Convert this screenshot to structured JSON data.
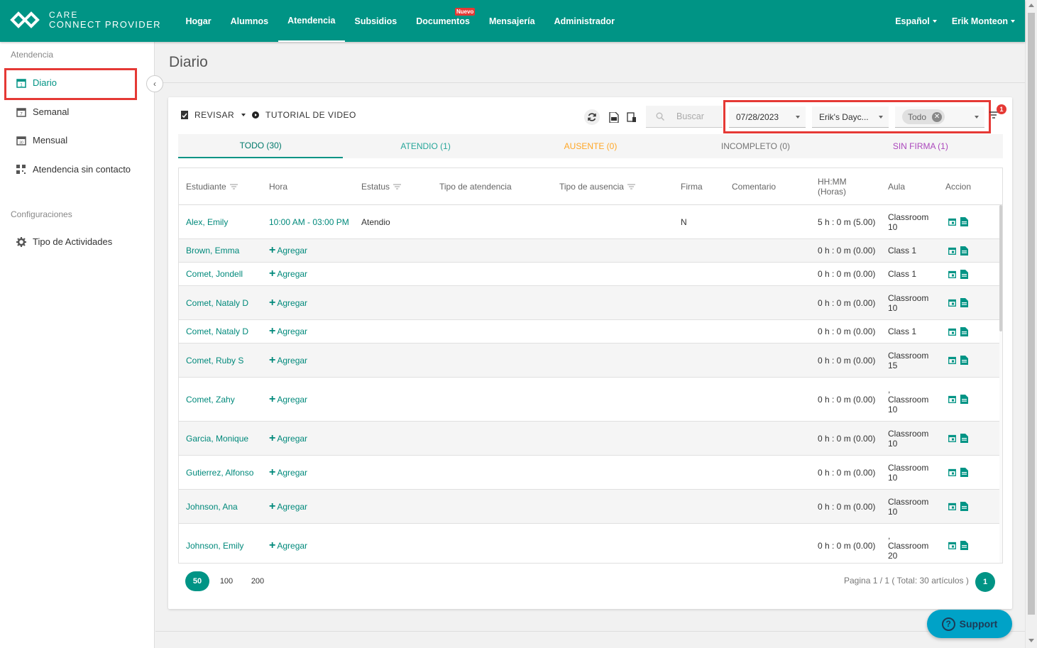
{
  "app": {
    "logo_line1": "CARE",
    "logo_line2": "CONNECT PROVIDER"
  },
  "nav": {
    "items": [
      "Hogar",
      "Alumnos",
      "Atendencia",
      "Subsidios",
      "Documentos",
      "Mensajería",
      "Administrador"
    ],
    "active": "Atendencia",
    "new_badge": "Nuevo"
  },
  "top_right": {
    "language": "Español",
    "user": "Erik Monteon"
  },
  "sidebar": {
    "section1": "Atendencia",
    "items": [
      {
        "label": "Diario",
        "icon": "calendar-day-icon",
        "active": true
      },
      {
        "label": "Semanal",
        "icon": "calendar-week-icon"
      },
      {
        "label": "Mensual",
        "icon": "calendar-month-icon"
      },
      {
        "label": "Atendencia sin contacto",
        "icon": "qr-code-icon"
      }
    ],
    "section2": "Configuraciones",
    "settings_items": [
      {
        "label": "Tipo de Actividades",
        "icon": "gear-icon"
      }
    ]
  },
  "page": {
    "title": "Diario"
  },
  "toolbar": {
    "revisar": "REVISAR",
    "tutorial": "TUTORIAL DE VIDEO",
    "search_placeholder": "Buscar",
    "date": "07/28/2023",
    "center": "Erik's Dayc...",
    "filter_chip": "Todo",
    "notification_count": "1"
  },
  "tabs": [
    {
      "label": "TODO (30)",
      "color": "#00796b",
      "active": true
    },
    {
      "label": "ATENDIO (1)",
      "color": "#26a69a"
    },
    {
      "label": "AUSENTE (0)",
      "color": "#ffa726"
    },
    {
      "label": "INCOMPLETO (0)",
      "color": "#757575"
    },
    {
      "label": "SIN FIRMA (1)",
      "color": "#ab47bc"
    }
  ],
  "table": {
    "headers": {
      "student": "Estudiante",
      "time": "Hora",
      "status": "Estatus",
      "attendance_type": "Tipo de atendencia",
      "absence_type": "Tipo de ausencia",
      "signature": "Firma",
      "comment": "Comentario",
      "hhmm": "HH:MM",
      "hours": "(Horas)",
      "classroom": "Aula",
      "action": "Accion"
    },
    "add_label": "Agregar",
    "rows": [
      {
        "student": "Alex, Emily",
        "time": "10:00 AM - 03:00 PM",
        "status": "Atendio",
        "signature": "N",
        "hours": "5 h : 0 m (5.00)",
        "classroom_pre": "",
        "classroom": "Classroom",
        "classroom2": "10"
      },
      {
        "student": "Brown, Emma",
        "time": "",
        "status": "",
        "signature": "",
        "hours": "0 h : 0 m (0.00)",
        "classroom_pre": "",
        "classroom": "Class 1",
        "classroom2": ""
      },
      {
        "student": "Comet, Jondell",
        "time": "",
        "status": "",
        "signature": "",
        "hours": "0 h : 0 m (0.00)",
        "classroom_pre": "",
        "classroom": "Class 1",
        "classroom2": ""
      },
      {
        "student": "Comet, Nataly D",
        "time": "",
        "status": "",
        "signature": "",
        "hours": "0 h : 0 m (0.00)",
        "classroom_pre": "",
        "classroom": "Classroom",
        "classroom2": "10"
      },
      {
        "student": "Comet, Nataly D",
        "time": "",
        "status": "",
        "signature": "",
        "hours": "0 h : 0 m (0.00)",
        "classroom_pre": "",
        "classroom": "Class 1",
        "classroom2": ""
      },
      {
        "student": "Comet, Ruby S",
        "time": "",
        "status": "",
        "signature": "",
        "hours": "0 h : 0 m (0.00)",
        "classroom_pre": "",
        "classroom": "Classroom",
        "classroom2": "15"
      },
      {
        "student": "Comet, Zahy",
        "time": "",
        "status": "",
        "signature": "",
        "hours": "0 h : 0 m (0.00)",
        "classroom_pre": ",",
        "classroom": "Classroom",
        "classroom2": "10"
      },
      {
        "student": "Garcia, Monique",
        "time": "",
        "status": "",
        "signature": "",
        "hours": "0 h : 0 m (0.00)",
        "classroom_pre": "",
        "classroom": "Classroom",
        "classroom2": "10"
      },
      {
        "student": "Gutierrez, Alfonso",
        "time": "",
        "status": "",
        "signature": "",
        "hours": "0 h : 0 m (0.00)",
        "classroom_pre": "",
        "classroom": "Classroom",
        "classroom2": "10"
      },
      {
        "student": "Johnson, Ana",
        "time": "",
        "status": "",
        "signature": "",
        "hours": "0 h : 0 m (0.00)",
        "classroom_pre": "",
        "classroom": "Classroom",
        "classroom2": "10"
      },
      {
        "student": "Johnson, Emily",
        "time": "",
        "status": "",
        "signature": "",
        "hours": "0 h : 0 m (0.00)",
        "classroom_pre": ",",
        "classroom": "Classroom",
        "classroom2": "20"
      }
    ]
  },
  "pagination": {
    "sizes": [
      "50",
      "100",
      "200"
    ],
    "active_size": "50",
    "info": "Pagina 1 / 1 ( Total: 30 artículos )",
    "current_page": "1"
  },
  "support": {
    "label": "Support"
  },
  "colors": {
    "primary": "#009485",
    "highlight": "#e53935",
    "support": "#00a2c7"
  }
}
